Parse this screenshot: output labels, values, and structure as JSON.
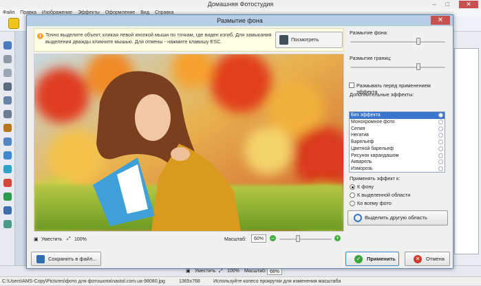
{
  "app": {
    "title": "Домашняя Фотостудия",
    "menu": [
      "Файл",
      "Правка",
      "Изображение",
      "Эффекты",
      "Оформление",
      "Вид",
      "Справка"
    ],
    "window_buttons": [
      "–",
      "□",
      "✕"
    ],
    "bottom": {
      "fit_label": "Уместить",
      "zoom_100": "100%",
      "scale_label": "Масштаб:",
      "scale_value": "68%"
    },
    "status": {
      "path": "C:\\Users\\AMS-Copy\\Pictures\\фото для фотошопа\\nastol.com.ua-98080.jpg",
      "size": "1365x768",
      "hint": "Используйте колесо прокрутки для изменения масштаба"
    }
  },
  "dialog": {
    "title": "Размытие фона",
    "hint_text": "Точно выделите объект, кликая левой кнопкой мыши по точкам, где виден изгиб. Для замыкания выделения дважды кликните мышью. Для отмены - нажмите клавишу ESC.",
    "video_button": "Посмотреть видеоурок",
    "fit_label": "Уместить",
    "zoom_100": "100%",
    "scale_label": "Масштаб:",
    "scale_value": "60%",
    "scale_slider_level": 0.35,
    "background_blur": {
      "label": "Размытие фона:",
      "level": 0.72
    },
    "edge_blur": {
      "label": "Размытие границ:",
      "level": 0.72
    },
    "blur_before_checkbox": {
      "label": "Размывать перед применением эффекта",
      "checked": false
    },
    "extra_effects_label": "Дополнительные эффекты:",
    "effects": [
      "Без эффекта",
      "Монохромное фото",
      "Сепия",
      "Негатив",
      "Барельеф",
      "Цветной барельеф",
      "Рисунок карандашом",
      "Акварель",
      "Изморозь"
    ],
    "selected_effect": "Без эффекта",
    "apply_to_label": "Применять эффект к:",
    "apply_options": [
      "К фону",
      "К выделенной области",
      "Ко всему фото"
    ],
    "apply_selected": "К фону",
    "select_other_button": "Выделить другую область",
    "save_button": "Сохранить в файл...",
    "apply_button": "Применить",
    "cancel_button": "Отмена"
  }
}
